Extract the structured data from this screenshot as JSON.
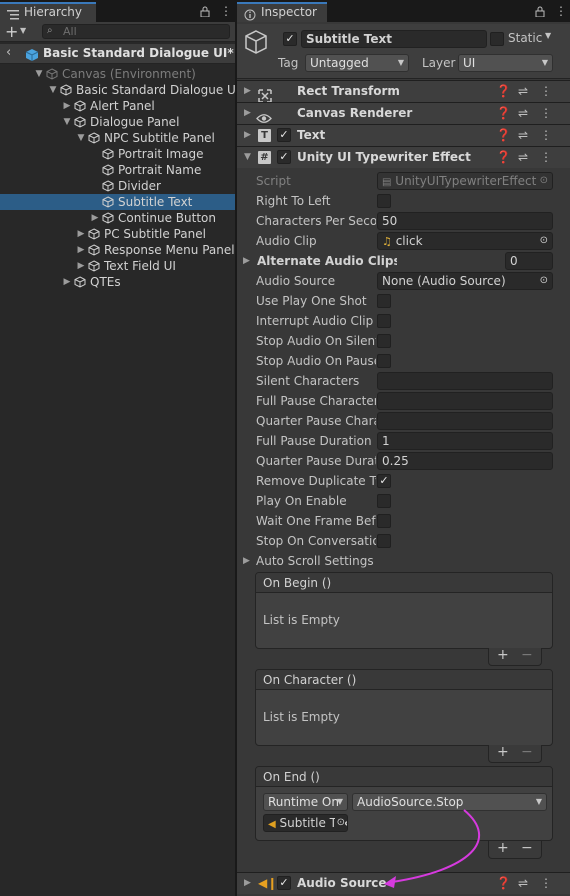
{
  "hierarchy": {
    "tab_label": "Hierarchy",
    "search_placeholder": "All",
    "scene_title": "Basic Standard Dialogue UI*",
    "items": [
      {
        "label": "Canvas (Environment)",
        "depth": 0,
        "arrow": "down",
        "dim": true
      },
      {
        "label": "Basic Standard Dialogue UI",
        "depth": 1,
        "arrow": "down"
      },
      {
        "label": "Alert Panel",
        "depth": 2,
        "arrow": "right"
      },
      {
        "label": "Dialogue Panel",
        "depth": 2,
        "arrow": "down"
      },
      {
        "label": "NPC Subtitle Panel",
        "depth": 3,
        "arrow": "down"
      },
      {
        "label": "Portrait Image",
        "depth": 4,
        "arrow": "none"
      },
      {
        "label": "Portrait Name",
        "depth": 4,
        "arrow": "none"
      },
      {
        "label": "Divider",
        "depth": 4,
        "arrow": "none"
      },
      {
        "label": "Subtitle Text",
        "depth": 4,
        "arrow": "none",
        "selected": true
      },
      {
        "label": "Continue Button",
        "depth": 4,
        "arrow": "right"
      },
      {
        "label": "PC Subtitle Panel",
        "depth": 3,
        "arrow": "right"
      },
      {
        "label": "Response Menu Panel",
        "depth": 3,
        "arrow": "right"
      },
      {
        "label": "Text Field UI",
        "depth": 3,
        "arrow": "right"
      },
      {
        "label": "QTEs",
        "depth": 2,
        "arrow": "right"
      }
    ]
  },
  "inspector": {
    "tab_label": "Inspector",
    "object_name": "Subtitle Text",
    "static_label": "Static",
    "tag_label": "Tag",
    "tag_value": "Untagged",
    "layer_label": "Layer",
    "layer_value": "UI",
    "components": {
      "rect_transform": "Rect Transform",
      "canvas_renderer": "Canvas Renderer",
      "text": "Text",
      "typewriter": "Unity UI Typewriter Effect",
      "audio_source": "Audio Source"
    },
    "props": {
      "script_label": "Script",
      "script_value": "UnityUITypewriterEffect",
      "right_to_left": "Right To Left",
      "chars_per_sec_label": "Characters Per Second",
      "chars_per_sec_value": "50",
      "audio_clip_label": "Audio Clip",
      "audio_clip_value": "click",
      "alt_clips_label": "Alternate Audio Clips",
      "alt_clips_value": "0",
      "audio_source_label": "Audio Source",
      "audio_source_value": "None (Audio Source)",
      "use_play_one_shot": "Use Play One Shot",
      "interrupt_audio_clip": "Interrupt Audio Clip",
      "stop_audio_on_silent": "Stop Audio On Silent",
      "stop_audio_on_pause": "Stop Audio On Pause",
      "silent_characters": "Silent Characters",
      "full_pause_chars": "Full Pause Characters",
      "quarter_pause_chars": "Quarter Pause Characters",
      "full_pause_duration_label": "Full Pause Duration",
      "full_pause_duration_value": "1",
      "quarter_pause_duration_label": "Quarter Pause Duration",
      "quarter_pause_duration_value": "0.25",
      "remove_duplicate_label": "Remove Duplicate Typewriter Effects",
      "play_on_enable": "Play On Enable",
      "wait_one_frame": "Wait One Frame Before Starting",
      "stop_on_conversation": "Stop On Conversation End",
      "auto_scroll": "Auto Scroll Settings"
    },
    "events": {
      "on_begin": "On Begin ()",
      "on_character": "On Character ()",
      "on_end": "On End ()",
      "list_empty": "List is Empty",
      "runtime_mode": "Runtime On",
      "method": "AudioSource.Stop",
      "target_object": "Subtitle Text"
    }
  },
  "colors": {
    "selection": "#2c5d87",
    "arrow": "#d63adf",
    "tab_accent": "#3a79bb"
  }
}
